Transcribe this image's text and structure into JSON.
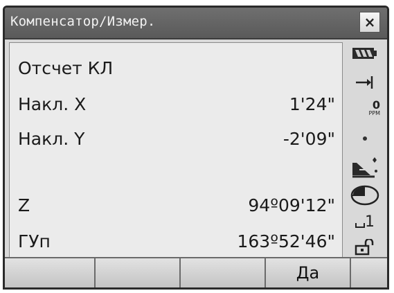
{
  "window": {
    "title": "Компенсатор/Измер.",
    "close_label": "×"
  },
  "main": {
    "heading": "Отсчет КЛ",
    "rows": [
      {
        "label": "Накл. X",
        "value": "1'24\""
      },
      {
        "label": "Накл. Y",
        "value": "-2'09\""
      },
      {
        "label": "Z",
        "value": "94º09'12\""
      },
      {
        "label": "ГУп",
        "value": "163º52'46\""
      }
    ]
  },
  "status": {
    "ppm_value": "0",
    "ppm_unit": "PPM",
    "target_index": "1",
    "icons": [
      "battery-icon",
      "target-arrow-icon",
      "ppm-icon",
      "dot-icon",
      "prism-icon",
      "laser-icon",
      "target-index-icon",
      "lock-icon"
    ]
  },
  "softkeys": [
    "",
    "",
    "",
    "Да",
    ""
  ]
}
